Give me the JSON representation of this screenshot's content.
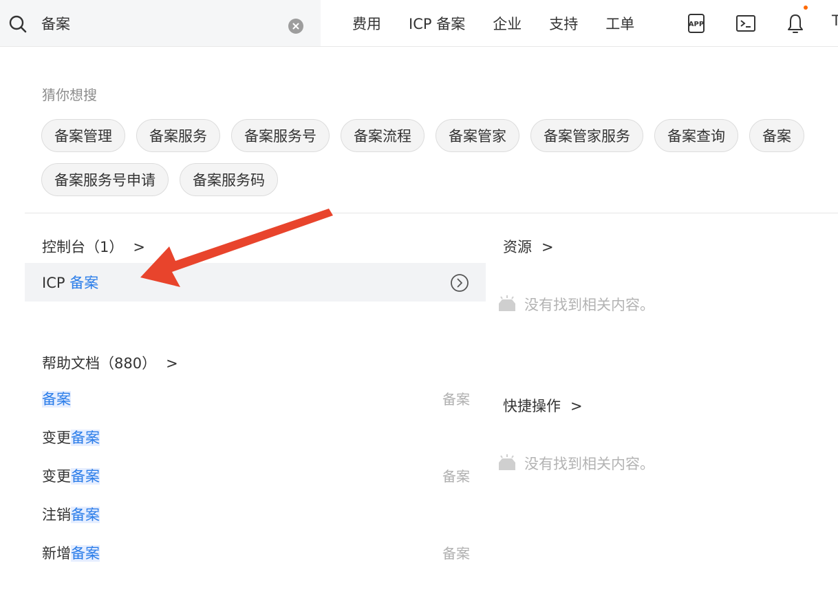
{
  "search": {
    "value": "备案",
    "placeholder": ""
  },
  "nav": {
    "items": [
      "费用",
      "ICP 备案",
      "企业",
      "支持",
      "工单"
    ],
    "cut_item": "T"
  },
  "suggestions": {
    "label": "猜你想搜",
    "row1": [
      "备案管理",
      "备案服务",
      "备案服务号",
      "备案流程",
      "备案管家",
      "备案管家服务",
      "备案查询",
      "备案"
    ],
    "row2": [
      "备案服务号申请",
      "备案服务码"
    ]
  },
  "console": {
    "title": "控制台（1）",
    "item_prefix": "ICP ",
    "item_highlight": "备案"
  },
  "docs": {
    "title": "帮助文档（880）",
    "items": [
      {
        "prefix": "",
        "highlight": "备案",
        "tag": "备案"
      },
      {
        "prefix": "变更",
        "highlight": "备案",
        "tag": ""
      },
      {
        "prefix": "变更",
        "highlight": "备案",
        "tag": "备案"
      },
      {
        "prefix": "注销",
        "highlight": "备案",
        "tag": ""
      },
      {
        "prefix": "新增",
        "highlight": "备案",
        "tag": "备案"
      }
    ]
  },
  "resources": {
    "title": "资源",
    "empty": "没有找到相关内容。"
  },
  "shortcuts": {
    "title": "快捷操作",
    "empty": "没有找到相关内容。"
  },
  "colors": {
    "highlight": "#2b7de9",
    "annotation": "#e8442c",
    "notify_dot": "#ff6a00"
  },
  "icons": {
    "search": "search-icon",
    "clear": "clear-icon",
    "app": "app-icon",
    "terminal": "terminal-icon",
    "bell": "bell-icon",
    "go": "circle-chevron-right-icon",
    "empty": "empty-tray-icon"
  }
}
